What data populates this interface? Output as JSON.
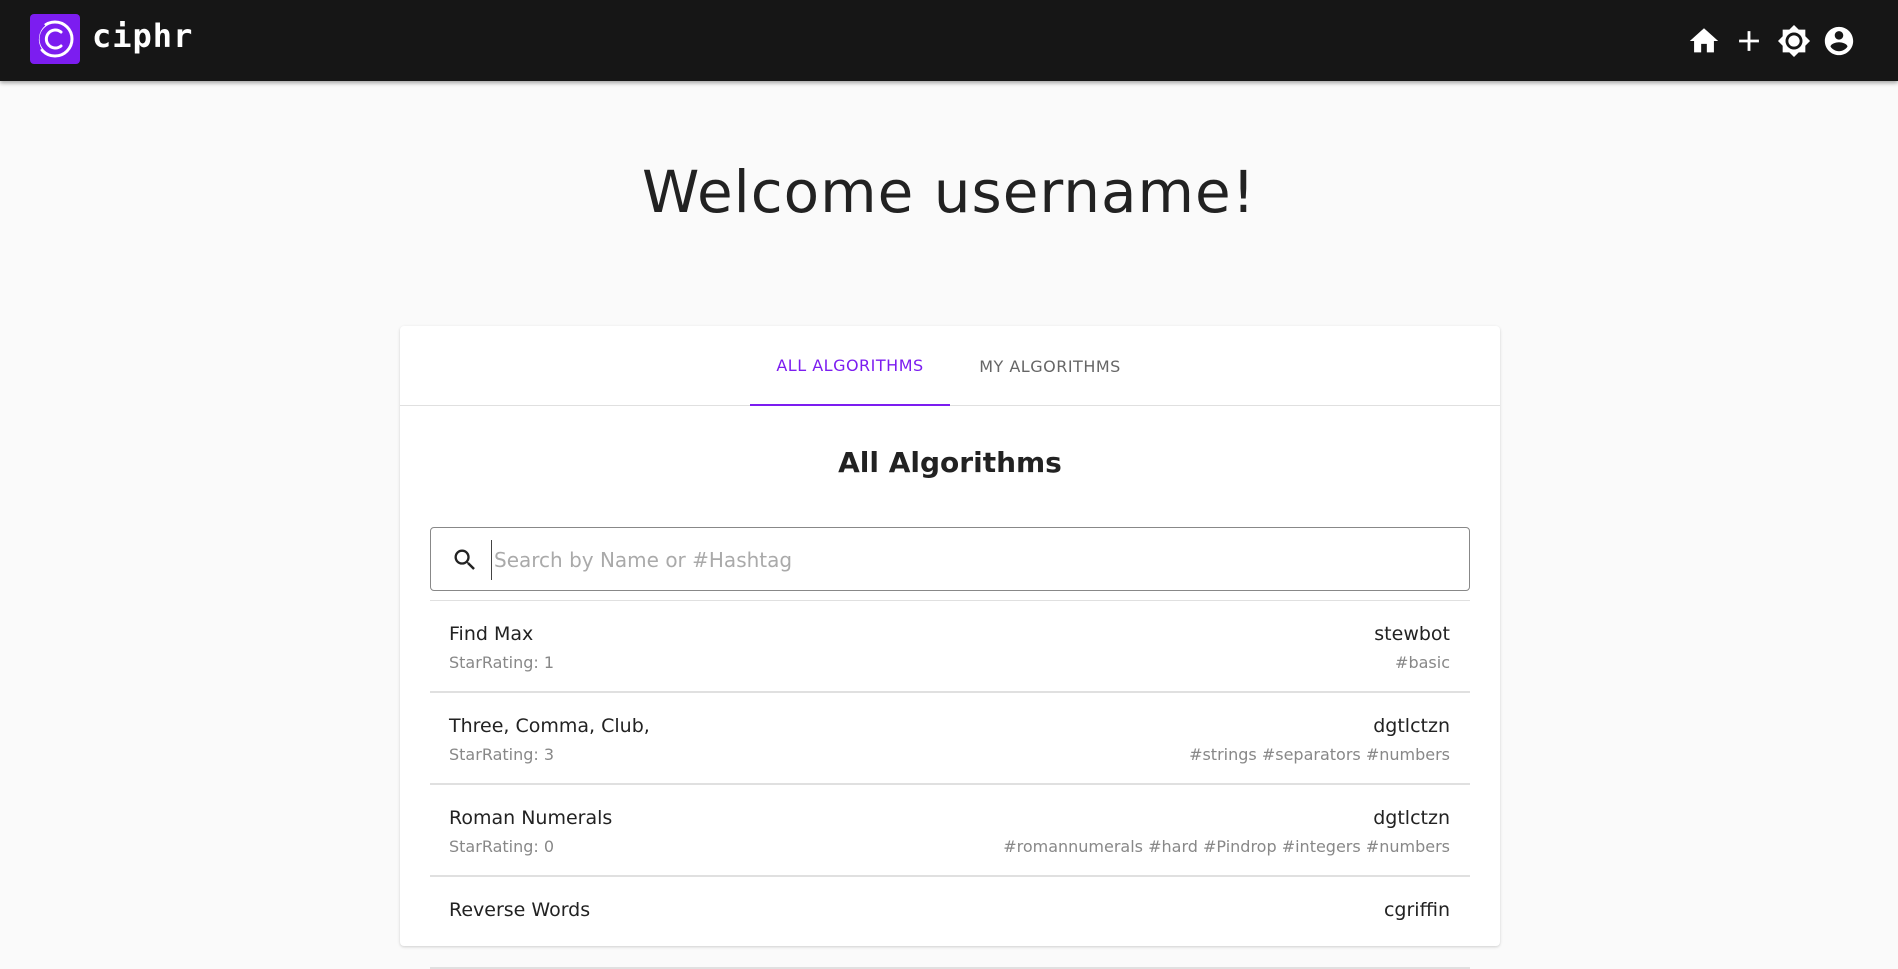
{
  "appbar": {
    "brand": "ciphr",
    "logo_color": "#7c1df0",
    "icons": [
      "home-icon",
      "add-icon",
      "theme-toggle-icon",
      "account-icon"
    ]
  },
  "welcome": "Welcome username!",
  "tabs": [
    {
      "label": "ALL ALGORITHMS",
      "active": true
    },
    {
      "label": "MY ALGORITHMS",
      "active": false
    }
  ],
  "section_title": "All Algorithms",
  "search": {
    "placeholder": "Search by Name or #Hashtag",
    "value": ""
  },
  "algorithms": [
    {
      "name": "Find Max",
      "rating": "StarRating: 1",
      "author": "stewbot",
      "tags": "#basic"
    },
    {
      "name": "Three, Comma, Club,",
      "rating": "StarRating: 3",
      "author": "dgtlctzn",
      "tags": "#strings #separators #numbers"
    },
    {
      "name": "Roman Numerals",
      "rating": "StarRating: 0",
      "author": "dgtlctzn",
      "tags": "#romannumerals #hard #Pindrop #integers #numbers"
    },
    {
      "name": "Reverse Words",
      "rating": "",
      "author": "cgriffin",
      "tags": ""
    }
  ],
  "colors": {
    "accent": "#7c1df0",
    "appbar": "#161616"
  }
}
